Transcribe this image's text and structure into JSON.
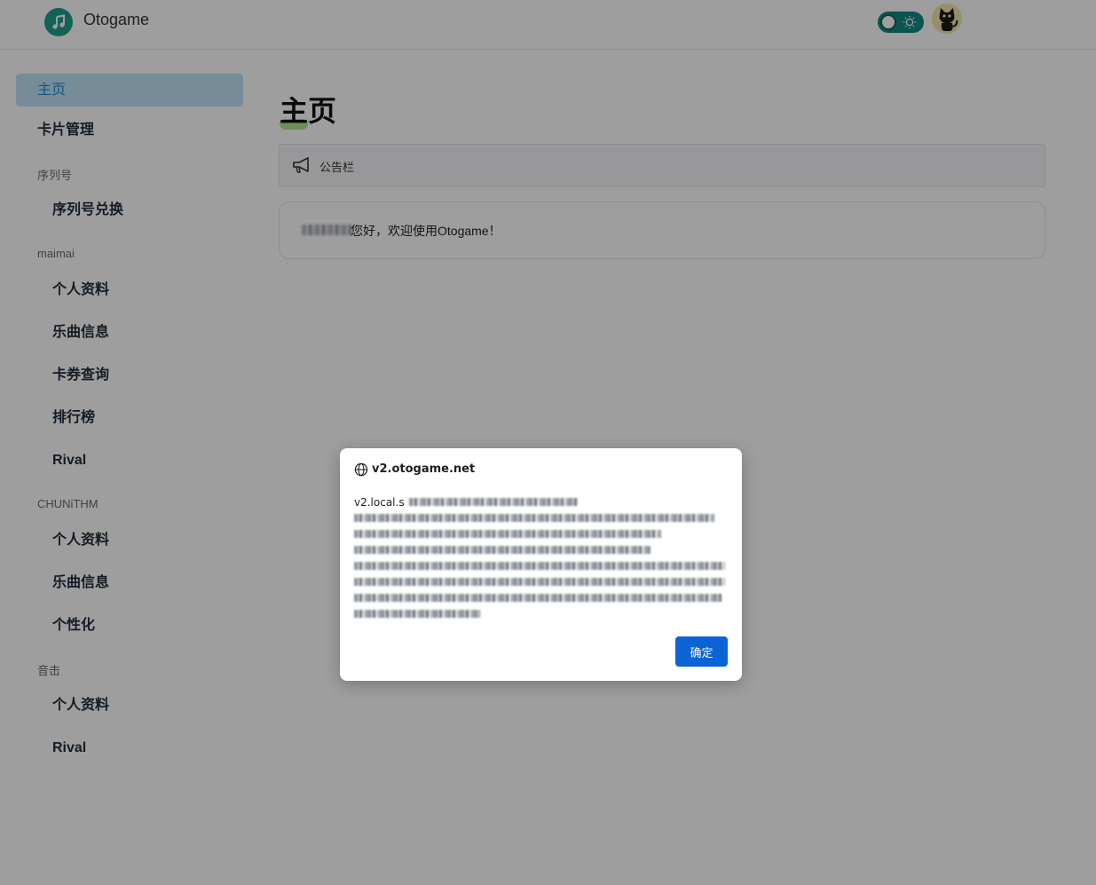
{
  "header": {
    "app_title": "Otogame",
    "logo_icon": "music-note-icon",
    "theme_toggle_icon": "sun-icon",
    "avatar_icon": "cat-avatar"
  },
  "sidebar": {
    "home": "主页",
    "card_management": "卡片管理",
    "groups": [
      {
        "label": "序列号",
        "items": [
          "序列号兑换"
        ]
      },
      {
        "label": "maimai",
        "items": [
          "个人资料",
          "乐曲信息",
          "卡券查询",
          "排行榜",
          "Rival"
        ]
      },
      {
        "label": "CHUNiTHM",
        "items": [
          "个人资料",
          "乐曲信息",
          "个性化"
        ]
      },
      {
        "label": "音击",
        "items": [
          "个人资料",
          "Rival"
        ]
      }
    ]
  },
  "main": {
    "title": "主页",
    "notice_label": "公告栏",
    "welcome_text": "您好，欢迎使用Otogame！"
  },
  "dialog": {
    "title": "v2.otogame.net",
    "message_start": "v2.local.s",
    "ok_label": "确定"
  },
  "colors": {
    "accent": "#1f9f8f",
    "active_nav_bg": "#bfe3f6",
    "active_nav_text": "#1a8bd0",
    "ok_button": "#0b63d6"
  }
}
